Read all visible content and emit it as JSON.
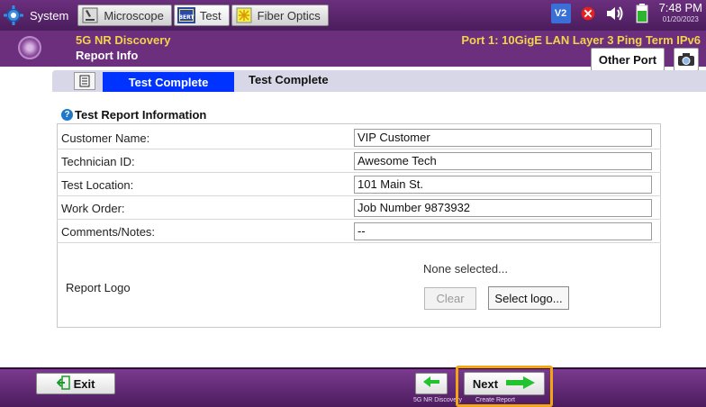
{
  "topbar": {
    "tabs": [
      {
        "label": "System",
        "icon": "gear-icon"
      },
      {
        "label": "Microscope",
        "icon": "microscope-icon"
      },
      {
        "label": "Test",
        "icon": "bert-test-icon",
        "icon_text": "JUL BERT"
      },
      {
        "label": "Fiber Optics",
        "icon": "fiber-optics-icon"
      }
    ],
    "status": {
      "v2_label": "V2",
      "time": "7:48 PM",
      "date": "01/20/2023"
    }
  },
  "header": {
    "title": "5G NR Discovery",
    "subtitle": "Report Info",
    "port_info": "Port 1: 10GigE LAN Layer 3 Ping Term IPv6",
    "other_port_label": "Other Port"
  },
  "tabs": {
    "active_label": "Test Complete",
    "plain_label": "Test Complete"
  },
  "form": {
    "section_title": "Test Report Information",
    "rows": [
      {
        "label": "Customer Name:",
        "value": "VIP Customer"
      },
      {
        "label": "Technician ID:",
        "value": "Awesome Tech"
      },
      {
        "label": "Test Location:",
        "value": "101 Main St."
      },
      {
        "label": "Work Order:",
        "value": "Job Number 9873932"
      },
      {
        "label": "Comments/Notes:",
        "value": "--"
      }
    ],
    "report_logo": {
      "label": "Report Logo",
      "status": "None selected...",
      "clear_label": "Clear",
      "select_label": "Select logo..."
    }
  },
  "bottom": {
    "exit_label": "Exit",
    "back_caption": "5G NR Discovery",
    "next_label": "Next",
    "next_caption": "Create Report"
  },
  "colors": {
    "header_purple": "#6b2f7e",
    "title_yellow": "#f2d34a",
    "active_tab_blue": "#0033ff",
    "highlight_orange": "#f3a514",
    "arrow_green": "#22c32e"
  }
}
